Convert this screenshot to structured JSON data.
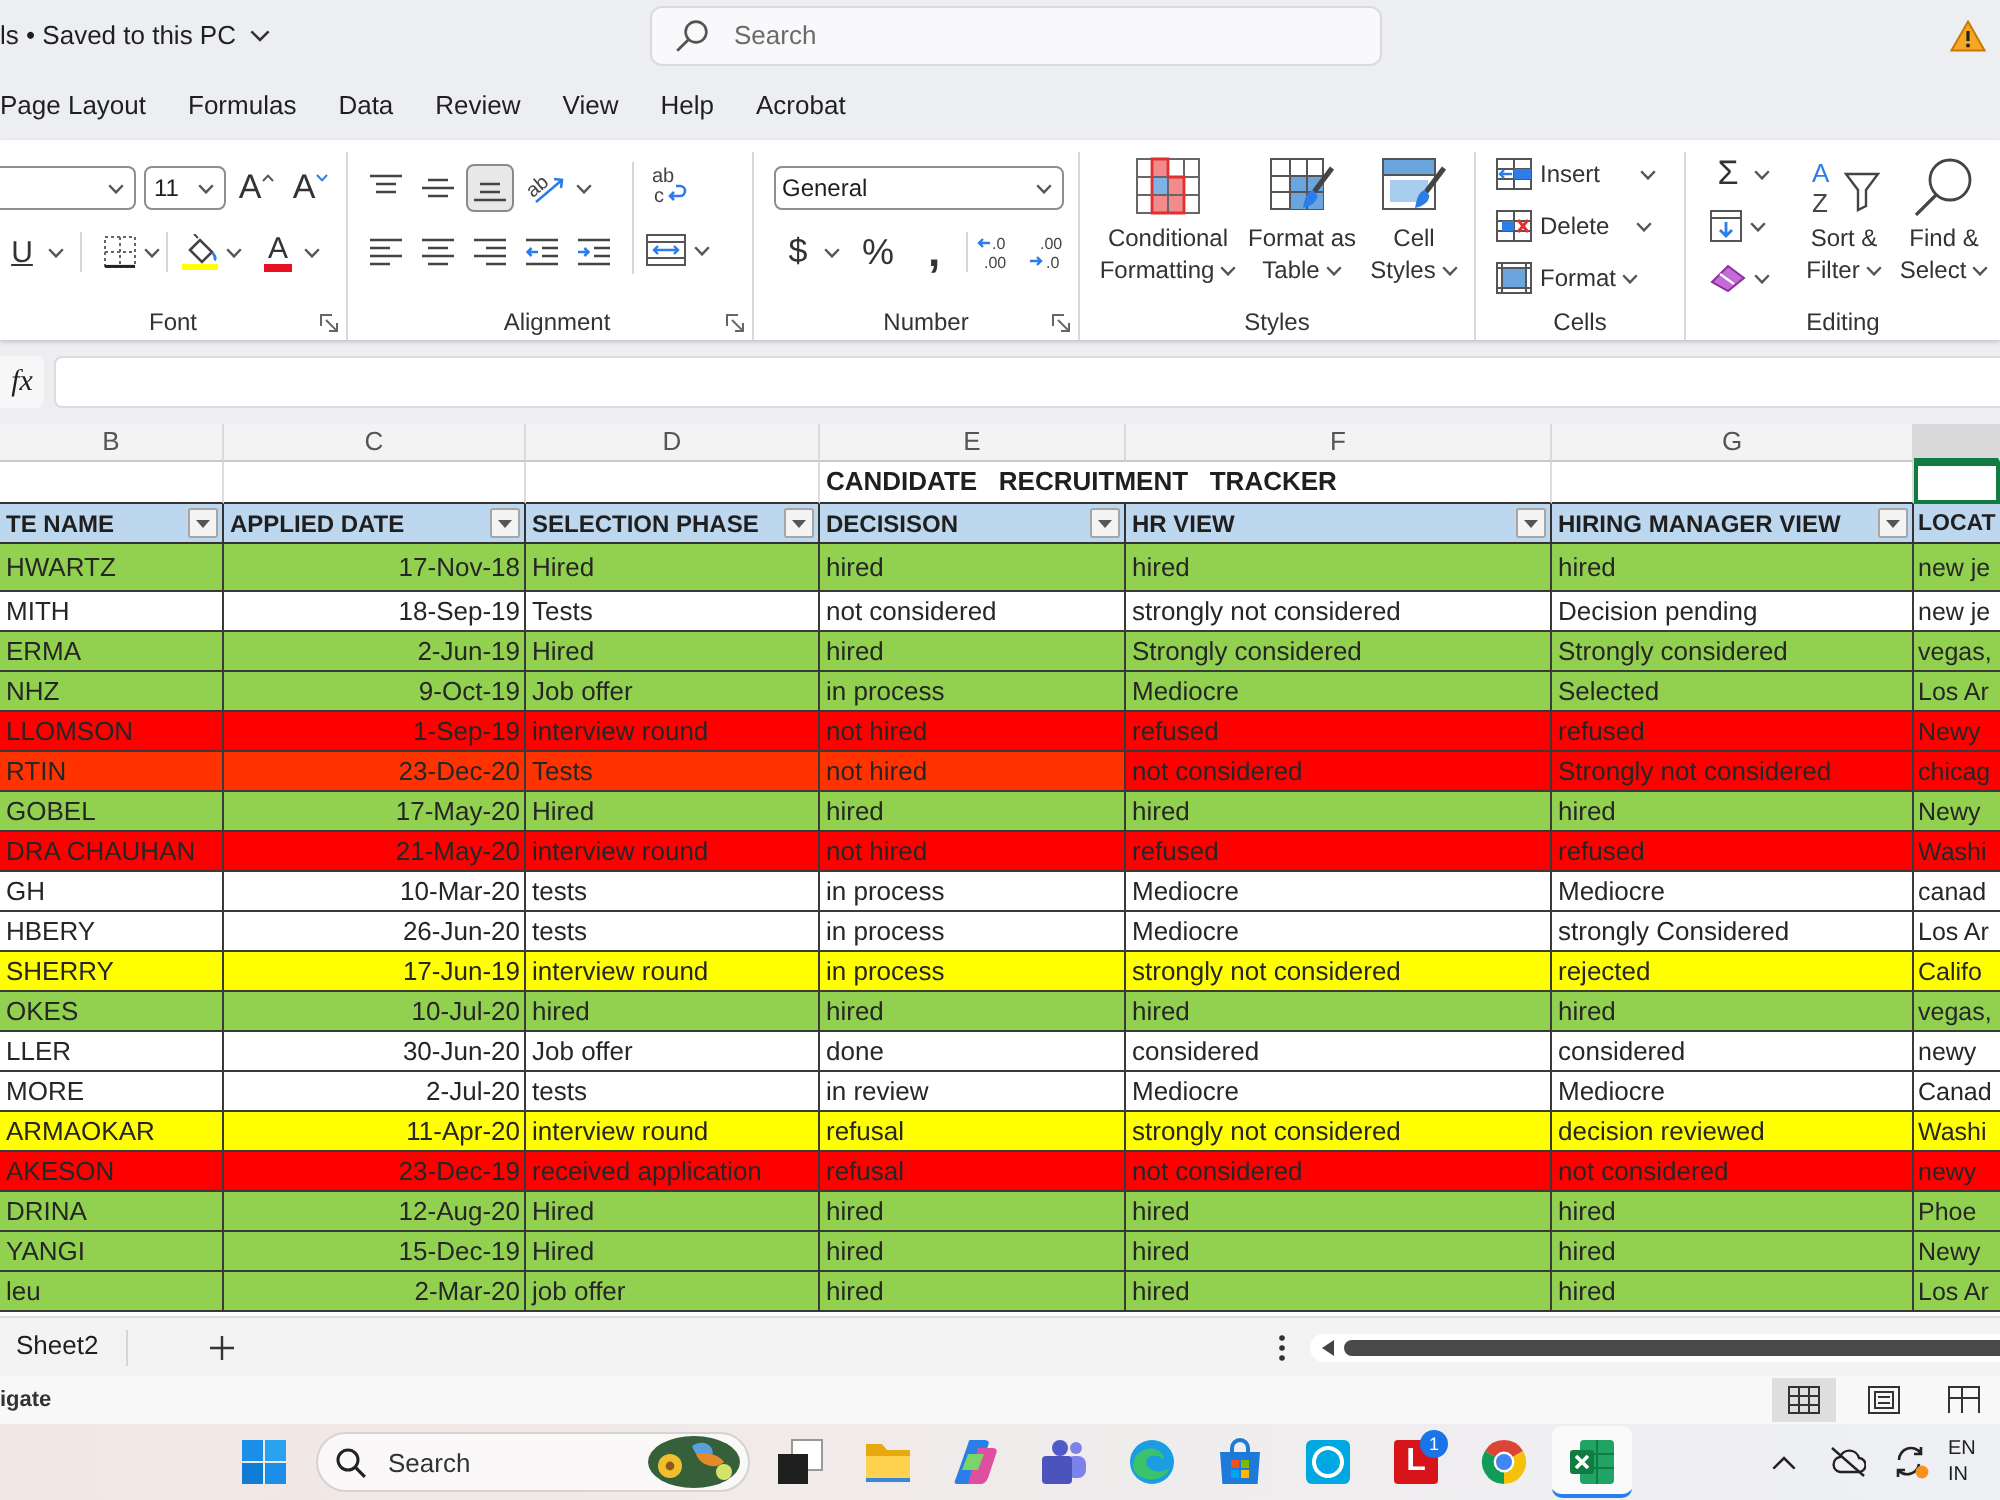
{
  "title_bar": {
    "document_title": "ls • Saved to this PC",
    "search": {
      "placeholder": "Search"
    }
  },
  "menu_tabs": [
    {
      "label": "Page Layout",
      "selected": false
    },
    {
      "label": "Formulas",
      "selected": false
    },
    {
      "label": "Data",
      "selected": false
    },
    {
      "label": "Review",
      "selected": false
    },
    {
      "label": "View",
      "selected": false
    },
    {
      "label": "Help",
      "selected": false
    },
    {
      "label": "Acrobat",
      "selected": false
    }
  ],
  "ribbon": {
    "font": {
      "label": "Font",
      "size": "11",
      "grow": "A",
      "shrink": "A",
      "underline": "U",
      "font_color": "A"
    },
    "alignment": {
      "label": "Alignment",
      "vertical_align": [
        {
          "kind": "top",
          "selected": false
        },
        {
          "kind": "middle",
          "selected": false
        },
        {
          "kind": "bottom",
          "selected": true
        }
      ],
      "orientation": "ab",
      "wrap": [
        "ab",
        "c"
      ]
    },
    "number": {
      "label": "Number",
      "format": "General",
      "currency": "$",
      "percent": "%",
      "comma": ",",
      "increase_decimal": [
        ".0",
        ".00"
      ],
      "decrease_decimal": [
        ".00",
        ".0"
      ]
    },
    "styles": {
      "label": "Styles",
      "buttons": [
        {
          "kind": "conditional-formatting",
          "lines": [
            "Conditional",
            "Formatting"
          ]
        },
        {
          "kind": "format-as-table",
          "lines": [
            "Format as",
            "Table"
          ]
        },
        {
          "kind": "cell-styles",
          "lines": [
            "Cell",
            "Styles"
          ]
        }
      ]
    },
    "cells": {
      "label": "Cells",
      "buttons": [
        {
          "kind": "insert",
          "label": "Insert"
        },
        {
          "kind": "delete",
          "label": "Delete"
        },
        {
          "kind": "format",
          "label": "Format"
        }
      ]
    },
    "editing": {
      "label": "Editing",
      "sum": "Σ",
      "sort_letters": [
        "A",
        "Z"
      ],
      "buttons": [
        {
          "kind": "sort-filter",
          "lines": [
            "Sort &",
            "Filter"
          ]
        },
        {
          "kind": "find-select",
          "lines": [
            "Find &",
            "Select"
          ]
        }
      ]
    }
  },
  "formula_bar": {
    "function_label": "fx"
  },
  "sheet": {
    "columns": [
      {
        "letter": "B",
        "selected": false
      },
      {
        "letter": "C",
        "selected": false
      },
      {
        "letter": "D",
        "selected": false
      },
      {
        "letter": "E",
        "selected": false
      },
      {
        "letter": "F",
        "selected": false
      },
      {
        "letter": "G",
        "selected": false
      },
      {
        "selected": true
      }
    ],
    "title": "CANDIDATE   RECRUITMENT   TRACKER",
    "headers": [
      "TE NAME",
      "APPLIED DATE",
      "SELECTION PHASE",
      "DECISISON",
      "HR VIEW",
      "HIRING MANAGER VIEW",
      "LOCAT"
    ],
    "rows": [
      {
        "segments": [
          {
            "color": "#92d050",
            "cells": [
              "HWARTZ",
              "17-Nov-18",
              "Hired",
              "hired",
              "hired",
              "hired",
              "new je"
            ]
          }
        ]
      },
      {
        "segments": [
          {
            "color": "#ffffff",
            "cells": [
              "MITH",
              "18-Sep-19",
              "Tests",
              "not considered",
              "strongly not considered",
              "Decision pending",
              "new je"
            ]
          }
        ]
      },
      {
        "segments": [
          {
            "color": "#92d050",
            "cells": [
              "ERMA",
              "2-Jun-19",
              "Hired",
              "hired",
              "Strongly considered",
              "Strongly considered",
              "vegas,"
            ]
          }
        ]
      },
      {
        "segments": [
          {
            "color": "#92d050",
            "cells": [
              "NHZ",
              "9-Oct-19",
              "Job offer",
              "in process",
              "Mediocre",
              "Selected",
              "Los Ar"
            ]
          }
        ]
      },
      {
        "segments": [
          {
            "color": "#ff0000",
            "cells": [
              "LLOMSON",
              "1-Sep-19",
              "interview round",
              "not hired",
              "refused",
              "refused",
              "Newy"
            ]
          }
        ]
      },
      {
        "segments": [
          {
            "color": "#ff3300",
            "cells": [
              "RTIN",
              "23-Dec-20",
              "Tests",
              "not hired"
            ]
          },
          {
            "color": "#ff0000",
            "cells": [
              "not considered",
              "Strongly not considered",
              "chicag"
            ]
          }
        ]
      },
      {
        "segments": [
          {
            "color": "#92d050",
            "cells": [
              "GOBEL",
              "17-May-20",
              "Hired",
              "hired",
              "hired",
              "hired",
              "Newy"
            ]
          }
        ]
      },
      {
        "segments": [
          {
            "color": "#ff0000",
            "cells": [
              "DRA CHAUHAN",
              "21-May-20",
              "interview round",
              "not hired",
              "refused",
              "refused",
              "Washi"
            ]
          }
        ]
      },
      {
        "segments": [
          {
            "color": "#ffffff",
            "cells": [
              "GH",
              "10-Mar-20",
              "tests",
              "in process",
              "Mediocre",
              "Mediocre",
              "canad"
            ]
          }
        ]
      },
      {
        "segments": [
          {
            "color": "#ffffff",
            "cells": [
              "HBERY",
              "26-Jun-20",
              "tests",
              "in process",
              "Mediocre",
              "strongly Considered",
              "Los Ar"
            ]
          }
        ]
      },
      {
        "segments": [
          {
            "color": "#ffff00",
            "cells": [
              "SHERRY",
              "17-Jun-19",
              "interview round",
              "in process",
              "strongly not considered",
              "rejected",
              "Califo"
            ]
          }
        ]
      },
      {
        "segments": [
          {
            "color": "#92d050",
            "cells": [
              "OKES",
              "10-Jul-20",
              "hired",
              "hired",
              "hired",
              "hired",
              "vegas,"
            ]
          }
        ]
      },
      {
        "segments": [
          {
            "color": "#ffffff",
            "cells": [
              "LLER",
              "30-Jun-20",
              "Job offer",
              "done",
              "considered",
              "considered",
              "newy"
            ]
          }
        ]
      },
      {
        "segments": [
          {
            "color": "#ffffff",
            "cells": [
              "MORE",
              "2-Jul-20",
              "tests",
              "in review",
              "Mediocre",
              "Mediocre",
              "Canad"
            ]
          }
        ]
      },
      {
        "segments": [
          {
            "color": "#ffff00",
            "cells": [
              "ARMAOKAR",
              "11-Apr-20",
              "interview round",
              "refusal",
              "strongly not considered",
              "decision reviewed",
              "Washi"
            ]
          }
        ]
      },
      {
        "segments": [
          {
            "color": "#ff0000",
            "cells": [
              "AKESON",
              "23-Dec-19",
              "received application",
              "refusal",
              "not considered",
              "not considered",
              "newy"
            ]
          }
        ]
      },
      {
        "segments": [
          {
            "color": "#92d050",
            "cells": [
              "DRINA",
              "12-Aug-20",
              "Hired",
              "hired",
              "hired",
              "hired",
              "Phoe"
            ]
          }
        ]
      },
      {
        "segments": [
          {
            "color": "#92d050",
            "cells": [
              "YANGI",
              "15-Dec-19",
              "Hired",
              "hired",
              "hired",
              "hired",
              "Newy"
            ]
          }
        ]
      },
      {
        "segments": [
          {
            "color": "#92d050",
            "cells": [
              "leu",
              "2-Mar-20",
              "job offer",
              "hired",
              "hired",
              "hired",
              "Los Ar"
            ]
          }
        ]
      }
    ]
  },
  "sheet_tabs": [
    {
      "label": "Sheet2",
      "selected": false
    }
  ],
  "status_bar": {
    "text": "igate",
    "views": [
      {
        "kind": "normal",
        "selected": true
      },
      {
        "kind": "page-layout",
        "selected": false
      },
      {
        "kind": "page-break",
        "selected": false
      }
    ]
  },
  "taskbar": {
    "search": {
      "placeholder": "Search"
    },
    "apps": [
      {
        "kind": "task-view",
        "active": false
      },
      {
        "kind": "folder",
        "active": false
      },
      {
        "kind": "copilot",
        "active": false
      },
      {
        "kind": "teams",
        "active": false
      },
      {
        "kind": "edge",
        "active": false
      },
      {
        "kind": "store",
        "active": false
      },
      {
        "kind": "ring",
        "active": false
      },
      {
        "kind": "letter",
        "label": "L",
        "badge": "1",
        "active": false
      },
      {
        "kind": "chrome",
        "active": false
      },
      {
        "kind": "excel",
        "active": true
      }
    ],
    "language": [
      "EN",
      "IN"
    ]
  }
}
